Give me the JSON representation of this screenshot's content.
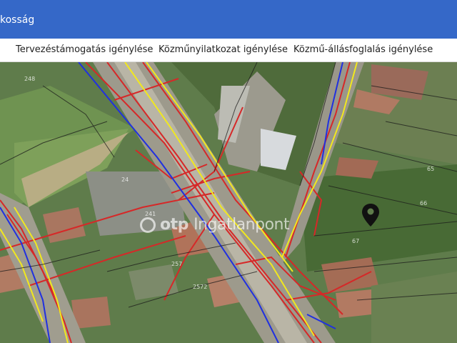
{
  "header": {
    "title": "kosság"
  },
  "tabs": [
    {
      "label": "Tervezéstámogatás igénylése"
    },
    {
      "label": "Közműnyilatkozat igénylése"
    },
    {
      "label": "Közmű-állásfoglalás igénylése"
    }
  ],
  "map": {
    "watermark": {
      "brand": "otp",
      "suffix": "Ingatlanpont"
    },
    "parcel_labels": [
      "248",
      "24",
      "65",
      "66",
      "67",
      "241",
      "257",
      "2572"
    ],
    "line_colors": {
      "red": "#d62828",
      "yellow": "#f1e81e",
      "blue": "#2030e0",
      "black": "#1a1a1a"
    },
    "marker_icon": "map-pin-icon"
  }
}
